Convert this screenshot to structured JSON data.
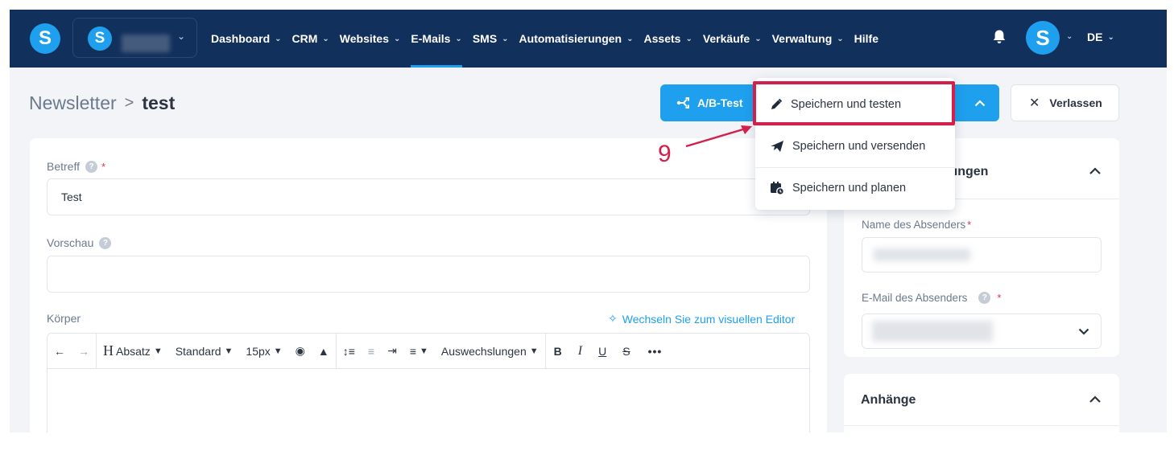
{
  "nav": {
    "items": [
      {
        "label": "Dashboard",
        "dropdown": true
      },
      {
        "label": "CRM",
        "dropdown": true
      },
      {
        "label": "Websites",
        "dropdown": true
      },
      {
        "label": "E-Mails",
        "dropdown": true,
        "active": true
      },
      {
        "label": "SMS",
        "dropdown": true
      },
      {
        "label": "Automatisierungen",
        "dropdown": true
      },
      {
        "label": "Assets",
        "dropdown": true
      },
      {
        "label": "Verkäufe",
        "dropdown": true
      },
      {
        "label": "Verwaltung",
        "dropdown": true
      },
      {
        "label": "Hilfe",
        "dropdown": false
      }
    ],
    "logo_letter": "S",
    "account_logo_letter": "S",
    "avatar_letter": "S",
    "language": "DE"
  },
  "breadcrumb": {
    "parent": "Newsletter",
    "separator": ">",
    "current": "test"
  },
  "actions": {
    "ab_test": "A/B-Test",
    "leave": "Verlassen",
    "save_menu": [
      {
        "label": "Speichern und testen",
        "icon": "pencil-icon",
        "highlighted": true
      },
      {
        "label": "Speichern und versenden",
        "icon": "paper-plane-icon"
      },
      {
        "label": "Speichern und planen",
        "icon": "calendar-clock-icon"
      }
    ]
  },
  "annotation": {
    "step_number": "9",
    "color": "#d21f4c"
  },
  "form": {
    "subject_label": "Betreff",
    "subject_value": "Test",
    "preview_label": "Vorschau",
    "preview_value": "",
    "body_label": "Körper",
    "switch_editor": "Wechseln Sie zum visuellen Editor",
    "toolbar": {
      "heading": "Absatz",
      "font": "Standard",
      "size": "15px",
      "replacements": "Auswechslungen"
    }
  },
  "sidebar": {
    "settings_title_partial": "lungen",
    "sender_name_label": "Name des Absenders",
    "sender_email_label": "E-Mail des Absenders",
    "attachments_title": "Anhänge"
  },
  "colors": {
    "nav_bg": "#12305c",
    "accent": "#1ea0ee",
    "page_bg": "#f2f4f8",
    "highlight": "#d21f4c"
  }
}
